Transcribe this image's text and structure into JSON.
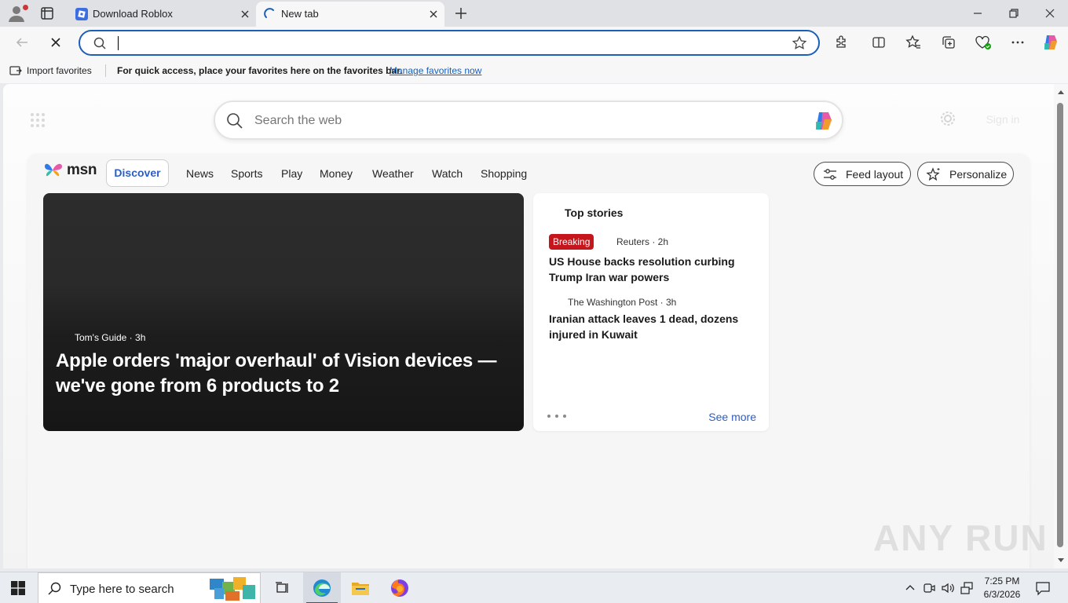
{
  "tabs": [
    {
      "title": "Download Roblox",
      "active": false
    },
    {
      "title": "New tab",
      "active": true
    }
  ],
  "address_bar": {
    "value": "",
    "placeholder": ""
  },
  "favorites_bar": {
    "import_label": "Import favorites",
    "message": "For quick access, place your favorites here on the favorites bar.",
    "manage_link": "Manage favorites now"
  },
  "page": {
    "search_placeholder": "Search the web",
    "sign_in": "Sign in"
  },
  "msn": {
    "logo_text": "msn",
    "nav": [
      "Discover",
      "News",
      "Sports",
      "Play",
      "Money",
      "Weather",
      "Watch",
      "Shopping"
    ],
    "feed_layout_label": "Feed layout",
    "personalize_label": "Personalize"
  },
  "hero": {
    "source": "Tom's Guide",
    "age": "3h",
    "title": "Apple orders 'major overhaul' of Vision devices — we've gone from 6 products to 2"
  },
  "top_stories": {
    "heading": "Top stories",
    "badge": "Breaking",
    "items": [
      {
        "source": "Reuters · 2h",
        "title": "US House backs resolution curbing Trump Iran war powers"
      },
      {
        "source": "The Washington Post · 3h",
        "title": "Iranian attack leaves 1 dead, dozens injured in Kuwait"
      }
    ],
    "see_more": "See more"
  },
  "watermark": "ANY RUN",
  "taskbar": {
    "search_placeholder": "Type here to search",
    "time": "7:25 PM",
    "date": "6/3/2026"
  },
  "colors": {
    "accent": "#1b5fb6",
    "msn_blue": "#2c5dc7",
    "breaking_red": "#c4161c"
  }
}
